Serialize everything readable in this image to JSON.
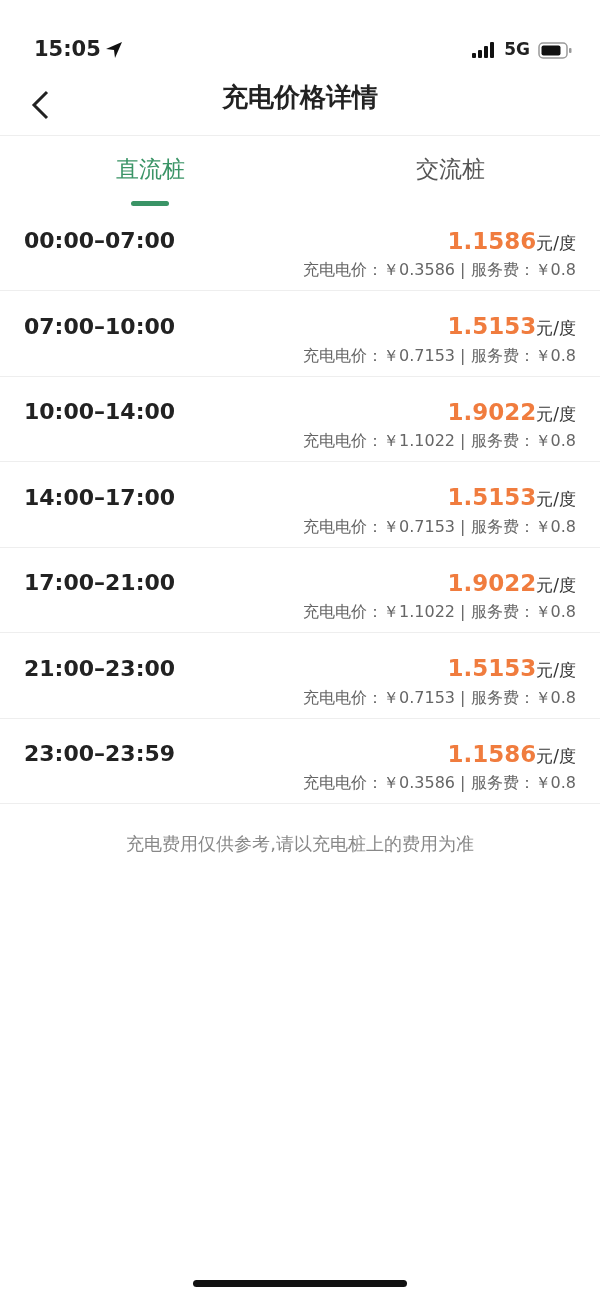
{
  "status_bar": {
    "time": "15:05",
    "network": "5G"
  },
  "header": {
    "title": "充电价格详情"
  },
  "tabs": [
    {
      "label": "直流桩",
      "selected": true
    },
    {
      "label": "交流桩",
      "selected": false
    }
  ],
  "rows": [
    {
      "time": "00:00–07:00",
      "price": "1.1586",
      "unit": "元/度",
      "detail": "充电电价：￥0.3586 | 服务费：￥0.8"
    },
    {
      "time": "07:00–10:00",
      "price": "1.5153",
      "unit": "元/度",
      "detail": "充电电价：￥0.7153 | 服务费：￥0.8"
    },
    {
      "time": "10:00–14:00",
      "price": "1.9022",
      "unit": "元/度",
      "detail": "充电电价：￥1.1022 | 服务费：￥0.8"
    },
    {
      "time": "14:00–17:00",
      "price": "1.5153",
      "unit": "元/度",
      "detail": "充电电价：￥0.7153 | 服务费：￥0.8"
    },
    {
      "time": "17:00–21:00",
      "price": "1.9022",
      "unit": "元/度",
      "detail": "充电电价：￥1.1022 | 服务费：￥0.8"
    },
    {
      "time": "21:00–23:00",
      "price": "1.5153",
      "unit": "元/度",
      "detail": "充电电价：￥0.7153 | 服务费：￥0.8"
    },
    {
      "time": "23:00–23:59",
      "price": "1.1586",
      "unit": "元/度",
      "detail": "充电电价：￥0.3586 | 服务费：￥0.8"
    }
  ],
  "note": "充电费用仅供参考,请以充电桩上的费用为准"
}
